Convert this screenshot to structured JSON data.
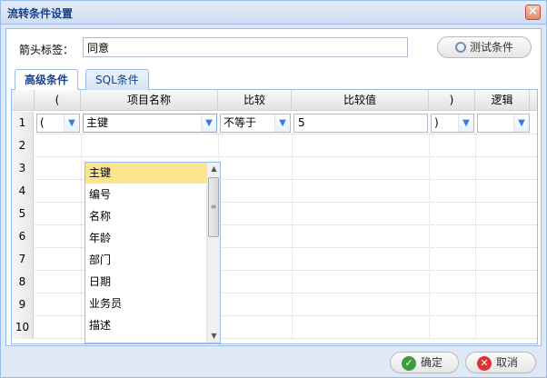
{
  "window": {
    "title": "流转条件设置",
    "close_glyph": "×"
  },
  "arrow": {
    "label": "箭头标签：",
    "value": "同意"
  },
  "test_button": {
    "label": "测试条件",
    "icon": "search-icon"
  },
  "tabs": [
    {
      "label": "高级条件",
      "active": true
    },
    {
      "label": "SQL条件",
      "active": false
    }
  ],
  "grid": {
    "headers": [
      "(",
      "项目名称",
      "比较",
      "比较值",
      ")",
      "逻辑"
    ],
    "row_numbers": [
      "1",
      "2",
      "3",
      "4",
      "5",
      "6",
      "7",
      "8",
      "9",
      "10"
    ],
    "row1": {
      "open_paren": "(",
      "field": "主键",
      "compare": "不等于",
      "value": "5",
      "close_paren": ")",
      "logic": ""
    }
  },
  "dropdown": {
    "items": [
      "主键",
      "编号",
      "名称",
      "年龄",
      "部门",
      "日期",
      "业务员",
      "描述"
    ],
    "selected": "主键"
  },
  "footer": {
    "ok_label": "确定",
    "cancel_label": "取消",
    "ok_icon": "checkmark-icon",
    "cancel_icon": "cancel-icon"
  },
  "colors": {
    "title_text": "#15428b",
    "border": "#99bbe8",
    "selected_item": "#fae58e"
  }
}
